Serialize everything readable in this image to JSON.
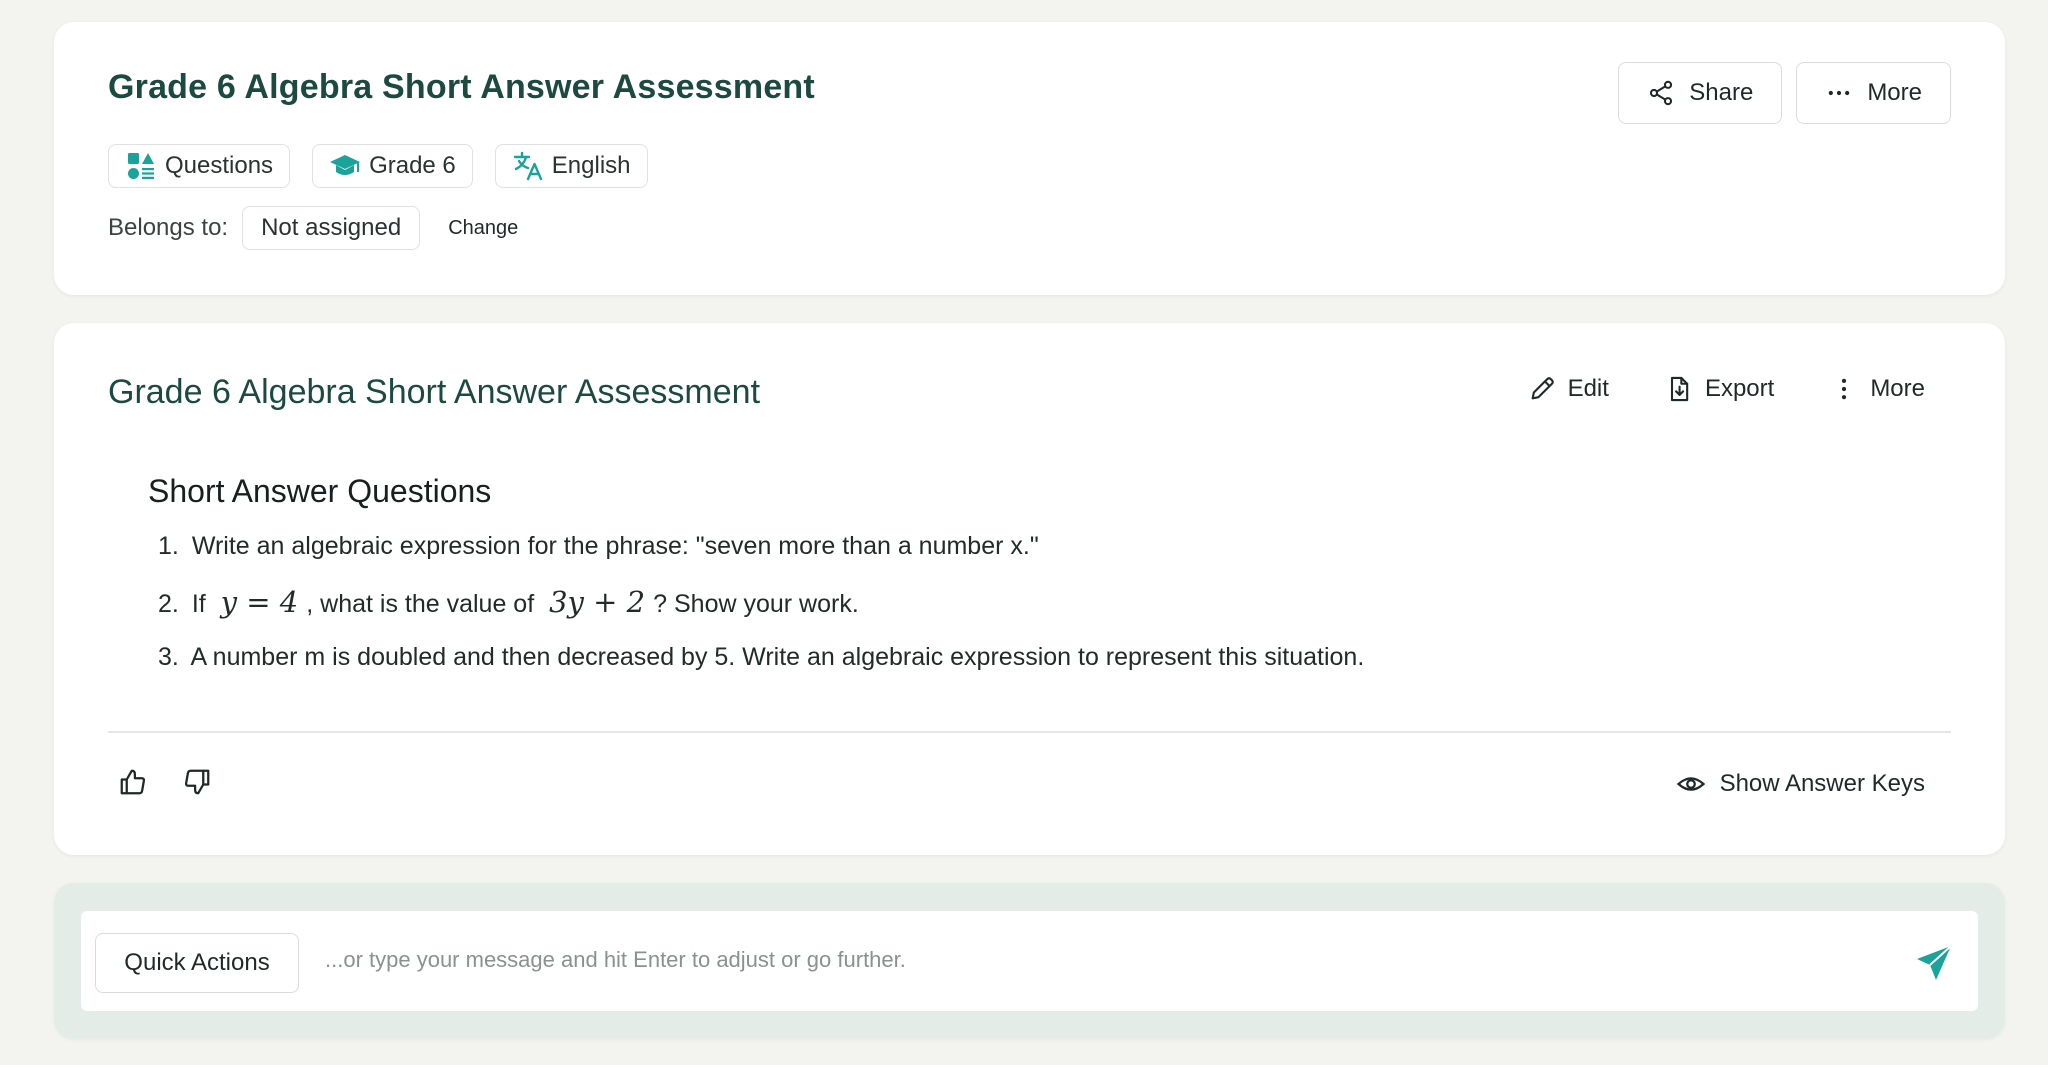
{
  "header": {
    "title": "Grade 6 Algebra Short Answer Assessment",
    "share_label": "Share",
    "more_label": "More",
    "chips": [
      {
        "label": "Questions",
        "icon": "shapes-icon"
      },
      {
        "label": "Grade 6",
        "icon": "graduation-cap-icon"
      },
      {
        "label": "English",
        "icon": "translate-icon"
      }
    ],
    "belongs_label": "Belongs to:",
    "belongs_value": "Not assigned",
    "change_label": "Change"
  },
  "main": {
    "title": "Grade 6 Algebra Short Answer Assessment",
    "edit_label": "Edit",
    "export_label": "Export",
    "more_label": "More",
    "section_heading": "Short Answer Questions",
    "questions": [
      {
        "num": "1.",
        "text": "Write an algebraic expression for the phrase: \"seven more than a number x.\""
      },
      {
        "num": "2.",
        "pre": "If",
        "math1": "y = 4",
        "mid": ", what is the value of",
        "math2": "3y + 2",
        "post": "? Show your work."
      },
      {
        "num": "3.",
        "text": "A number m is doubled and then decreased by 5. Write an algebraic expression to represent this situation."
      }
    ],
    "show_keys_label": "Show Answer Keys"
  },
  "chat": {
    "quick_actions_label": "Quick Actions",
    "placeholder": "...or type your message and hit Enter to adjust or go further."
  },
  "colors": {
    "accent": "#1aa39a",
    "title": "#1d4a40",
    "background": "#f3f4f0"
  }
}
